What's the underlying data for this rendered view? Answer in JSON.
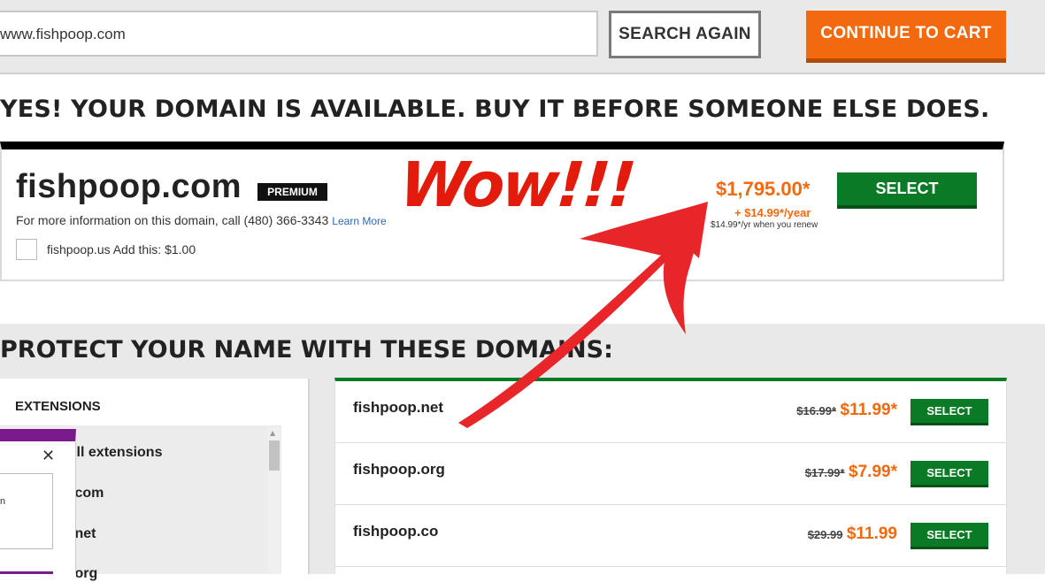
{
  "search": {
    "value": "www.fishpoop.com",
    "again_label": "SEARCH AGAIN"
  },
  "cart": {
    "label": "CONTINUE TO CART"
  },
  "headline": "YES! YOUR DOMAIN IS AVAILABLE. BUY IT BEFORE SOMEONE ELSE DOES.",
  "featured": {
    "domain": "fishpoop.com",
    "badge": "PREMIUM",
    "info": "For more information on this domain, call (480) 366-3343",
    "learn_more": "Learn More",
    "addon": "fishpoop.us Add this: $1.00",
    "price": "$1,795.00*",
    "renewal": "+ $14.99*/year",
    "renew_note": "$14.99*/yr when you renew",
    "select_label": "SELECT"
  },
  "annotation": {
    "text": "Wow!!!",
    "color": "#e31b0d"
  },
  "protect": {
    "title": "PROTECT YOUR NAME WITH THESE DOMAINS:",
    "extensions_header": "EXTENSIONS",
    "extensions": [
      "All extensions",
      ".com",
      ".net",
      ".org"
    ],
    "popup_close": "✕",
    "popup_text": "n"
  },
  "results": [
    {
      "domain": "fishpoop.net",
      "old_price": "$16.99*",
      "price": "$11.99*",
      "select_label": "SELECT"
    },
    {
      "domain": "fishpoop.org",
      "old_price": "$17.99*",
      "price": "$7.99*",
      "select_label": "SELECT"
    },
    {
      "domain": "fishpoop.co",
      "old_price": "$29.99",
      "price": "$11.99",
      "select_label": "SELECT"
    }
  ],
  "colors": {
    "accent_orange": "#f2690f",
    "select_green": "#0a7a27",
    "popup_purple": "#7b1a8d"
  }
}
